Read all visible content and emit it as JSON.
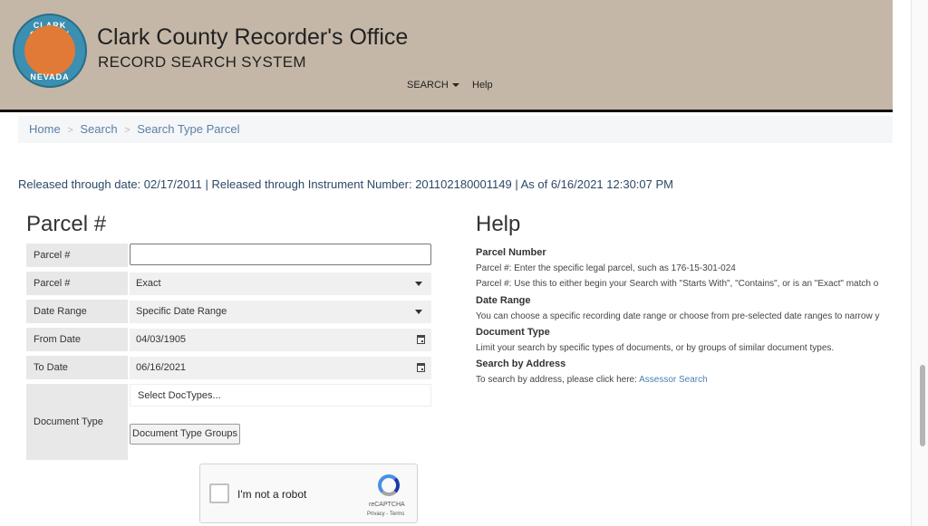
{
  "header": {
    "logo_text_top": "CLARK COUNTY",
    "logo_text_bottom": "NEVADA",
    "title": "Clark County Recorder's Office",
    "subtitle": "RECORD SEARCH SYSTEM",
    "nav": {
      "search": "SEARCH",
      "help": "Help"
    }
  },
  "breadcrumb": {
    "home": "Home",
    "search": "Search",
    "current": "Search Type Parcel",
    "separator": ">"
  },
  "release_info": "Released through date: 02/17/2011 | Released through Instrument Number: 201102180001149 | As of 6/16/2021 12:30:07 PM",
  "form": {
    "heading": "Parcel #",
    "parcel_label": "Parcel #",
    "parcel_value": "",
    "match_label": "Parcel #",
    "match_value": "Exact",
    "date_range_label": "Date Range",
    "date_range_value": "Specific Date Range",
    "from_date_label": "From Date",
    "from_date_value": "04/03/1905",
    "to_date_label": "To Date",
    "to_date_value": "06/16/2021",
    "doc_type_label": "Document Type",
    "doc_type_placeholder": "Select DocTypes...",
    "doc_type_groups_button": "Document Type Groups"
  },
  "captcha": {
    "label": "I'm not a robot",
    "brand": "reCAPTCHA",
    "terms": "Privacy - Terms"
  },
  "help": {
    "heading": "Help",
    "parcel_number_title": "Parcel Number",
    "parcel_number_text1": "Parcel #: Enter the specific legal parcel, such as 176-15-301-024",
    "parcel_number_text2": "Parcel #: Use this to either begin your Search with \"Starts With\", \"Contains\", or is an \"Exact\" match o",
    "date_range_title": "Date Range",
    "date_range_text": "You can choose a specific recording date range or choose from pre-selected date ranges to narrow y",
    "document_type_title": "Document Type",
    "document_type_text": "Limit your search by specific types of documents, or by groups of similar document types.",
    "address_title": "Search by Address",
    "address_text": "To search by address, please click here:",
    "address_link": "Assessor Search"
  },
  "colors": {
    "header_bg": "#c5b7a7",
    "link": "#5a7fa8",
    "release_text": "#2c4966"
  }
}
